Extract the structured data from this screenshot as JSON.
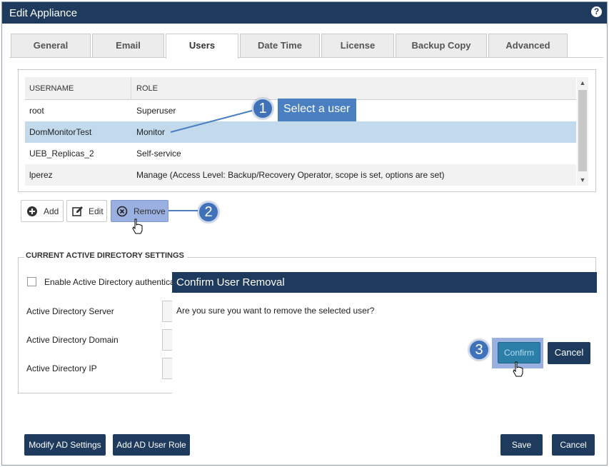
{
  "window": {
    "title": "Edit Appliance",
    "help_glyph": "?"
  },
  "tabs": [
    {
      "label": "General",
      "active": false
    },
    {
      "label": "Email",
      "active": false
    },
    {
      "label": "Users",
      "active": true
    },
    {
      "label": "Date Time",
      "active": false
    },
    {
      "label": "License",
      "active": false
    },
    {
      "label": "Backup Copy",
      "active": false
    },
    {
      "label": "Advanced",
      "active": false
    }
  ],
  "users_table": {
    "columns": [
      "USERNAME",
      "ROLE"
    ],
    "rows": [
      {
        "username": "root",
        "role": "Superuser",
        "selected": false
      },
      {
        "username": "DomMonitorTest",
        "role": "Monitor",
        "selected": true
      },
      {
        "username": "UEB_Replicas_2",
        "role": "Self-service",
        "selected": false
      },
      {
        "username": "lperez",
        "role": "Manage (Access Level: Backup/Recovery Operator, scope is set, options are set)",
        "selected": false
      }
    ]
  },
  "toolbar": {
    "add_label": "Add",
    "edit_label": "Edit",
    "remove_label": "Remove"
  },
  "callouts": {
    "step1_number": "1",
    "step1_text": "Select a user",
    "step2_number": "2",
    "step3_number": "3"
  },
  "ad_settings": {
    "legend": "CURRENT ACTIVE DIRECTORY SETTINGS",
    "enable_label": "Enable Active Directory authentica",
    "server_label": "Active Directory Server",
    "domain_label": "Active Directory Domain",
    "ip_label": "Active Directory IP"
  },
  "confirm_dialog": {
    "title": "Confirm User Removal",
    "message": "Are you sure you want to remove the selected user?",
    "confirm_label": "Confirm",
    "cancel_label": "Cancel"
  },
  "footer": {
    "modify_ad_label": "Modify AD Settings",
    "add_ad_role_label": "Add AD User Role",
    "save_label": "Save",
    "cancel_label": "Cancel"
  },
  "colors": {
    "header_navy": "#1e3a5c",
    "selected_row": "#c3d9ec",
    "callout_blue": "#3f72b8",
    "highlight": "#9ab0e0"
  }
}
